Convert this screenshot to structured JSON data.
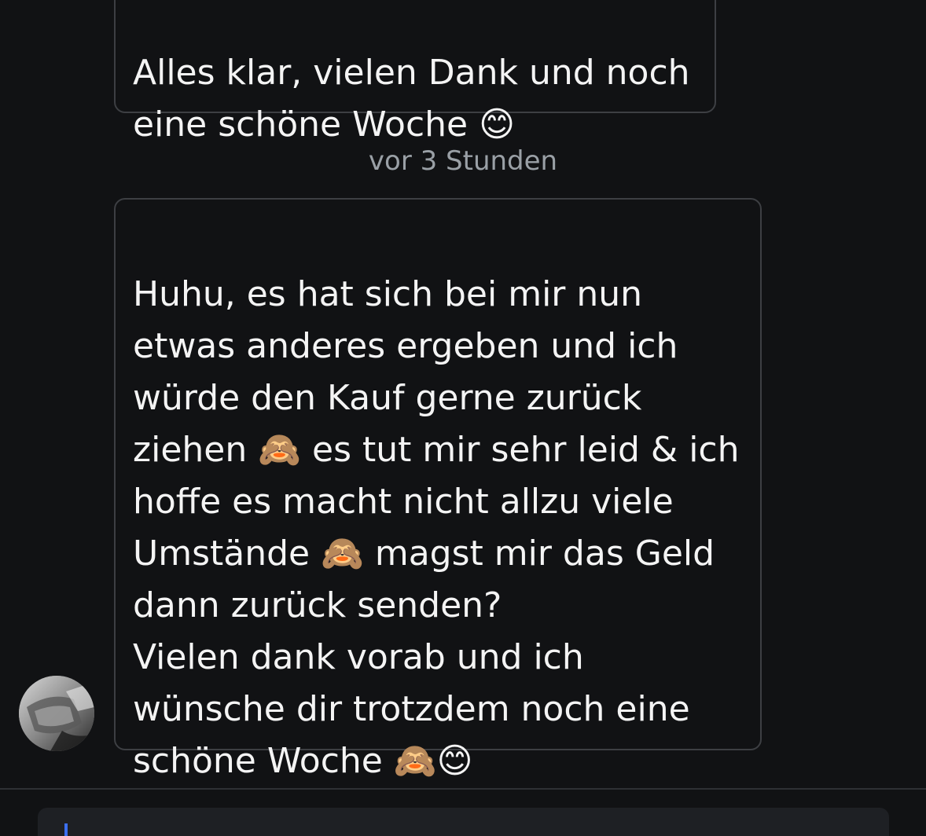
{
  "messages": [
    {
      "text": "Alles klar, vielen Dank und noch\neine schöne Woche 😊"
    },
    {
      "text": "Huhu, es hat sich bei mir nun\netwas anderes ergeben und ich\nwürde den Kauf gerne zurück\nziehen 🙈 es tut mir sehr leid & ich\nhoffe es macht nicht allzu viele\nUmstände 🙈 magst mir das Geld\ndann zurück senden?\nVielen dank vorab und ich\nwünsche dir trotzdem noch eine\nschöne Woche 🙈😊"
    }
  ],
  "timestamp": "vor 3 Stunden",
  "composer": {
    "value": "",
    "accent_color": "#3b6ff0"
  },
  "colors": {
    "background": "#111214",
    "bubble_border": "#3d3f43",
    "timestamp": "#9aa0a6"
  },
  "avatar": {
    "icon": "user-photo-avatar"
  }
}
